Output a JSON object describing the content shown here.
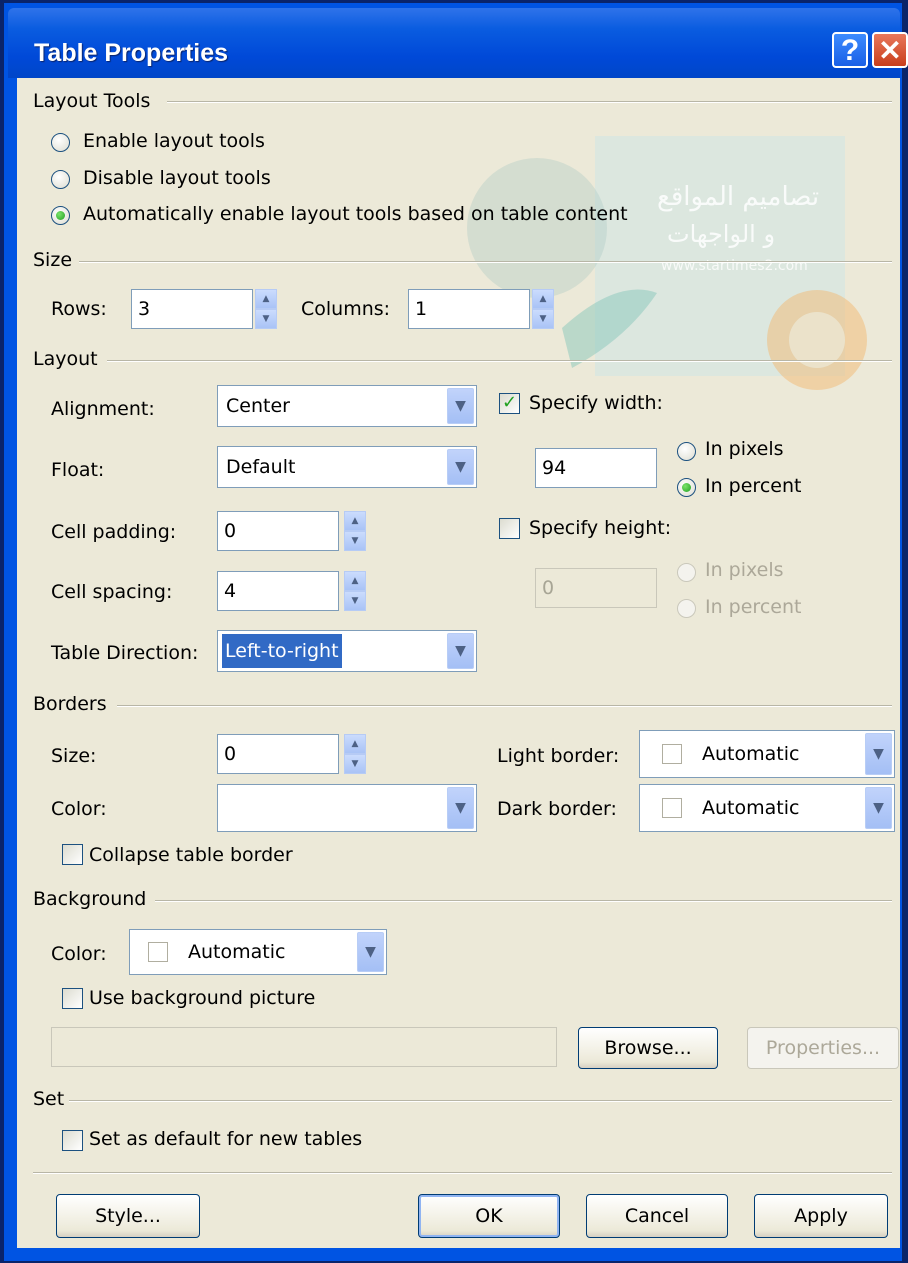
{
  "window": {
    "title": "Table Properties",
    "help_button": "?",
    "close_button": "✕"
  },
  "watermark": {
    "line1": "تصاميم المواقع",
    "line2": "و الواجهات",
    "url": "www.startimes2.com"
  },
  "layout_tools": {
    "heading": "Layout Tools",
    "options": [
      "Enable layout tools",
      "Disable layout tools",
      "Automatically enable layout tools based on table content"
    ],
    "selected_index": 2
  },
  "size": {
    "heading": "Size",
    "rows_label": "Rows:",
    "rows_value": "3",
    "columns_label": "Columns:",
    "columns_value": "1"
  },
  "layout": {
    "heading": "Layout",
    "alignment_label": "Alignment:",
    "alignment_value": "Center",
    "float_label": "Float:",
    "float_value": "Default",
    "cell_padding_label": "Cell padding:",
    "cell_padding_value": "0",
    "cell_spacing_label": "Cell spacing:",
    "cell_spacing_value": "4",
    "table_direction_label": "Table Direction:",
    "table_direction_value": "Left-to-right",
    "specify_width_label": "Specify width:",
    "specify_width_checked": true,
    "width_value": "94",
    "width_in_pixels": "In pixels",
    "width_in_percent": "In percent",
    "width_unit_selected": "In percent",
    "specify_height_label": "Specify height:",
    "specify_height_checked": false,
    "height_value": "0",
    "height_in_pixels": "In pixels",
    "height_in_percent": "In percent"
  },
  "borders": {
    "heading": "Borders",
    "size_label": "Size:",
    "size_value": "0",
    "color_label": "Color:",
    "color_value": "",
    "light_border_label": "Light border:",
    "light_border_value": "Automatic",
    "dark_border_label": "Dark border:",
    "dark_border_value": "Automatic",
    "collapse_label": "Collapse table border",
    "collapse_checked": false
  },
  "background": {
    "heading": "Background",
    "color_label": "Color:",
    "color_value": "Automatic",
    "use_picture_label": "Use background picture",
    "use_picture_checked": false,
    "picture_path": "",
    "browse_button": "Browse...",
    "properties_button": "Properties..."
  },
  "set": {
    "heading": "Set",
    "default_label": "Set as default for new tables",
    "default_checked": false
  },
  "footer": {
    "style_button": "Style...",
    "ok_button": "OK",
    "cancel_button": "Cancel",
    "apply_button": "Apply"
  },
  "colors": {
    "title_bar": "#0054e3",
    "dialog_face": "#ece9d8",
    "selection": "#316ac5",
    "check_green": "#21a121"
  }
}
